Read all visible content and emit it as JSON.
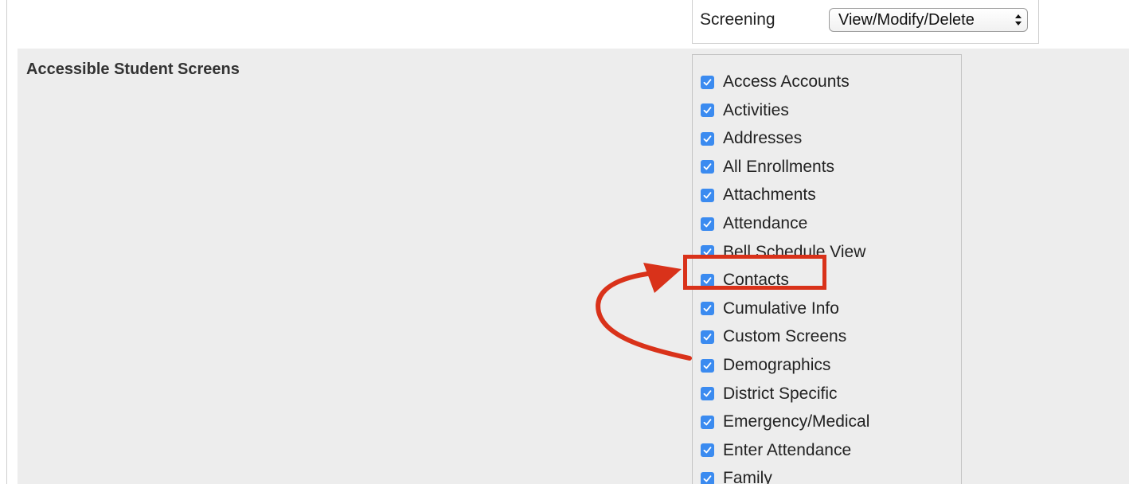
{
  "screening": {
    "label": "Screening",
    "selected_value": "View/Modify/Delete"
  },
  "accessible_screens": {
    "title": "Accessible Student Screens",
    "items": [
      {
        "label": "Access Accounts",
        "checked": true
      },
      {
        "label": "Activities",
        "checked": true
      },
      {
        "label": "Addresses",
        "checked": true
      },
      {
        "label": "All Enrollments",
        "checked": true
      },
      {
        "label": "Attachments",
        "checked": true
      },
      {
        "label": "Attendance",
        "checked": true
      },
      {
        "label": "Bell Schedule View",
        "checked": true
      },
      {
        "label": "Contacts",
        "checked": true
      },
      {
        "label": "Cumulative Info",
        "checked": true
      },
      {
        "label": "Custom Screens",
        "checked": true
      },
      {
        "label": "Demographics",
        "checked": true
      },
      {
        "label": "District Specific",
        "checked": true
      },
      {
        "label": "Emergency/Medical",
        "checked": true
      },
      {
        "label": "Enter Attendance",
        "checked": true
      },
      {
        "label": "Family",
        "checked": true
      }
    ]
  },
  "annotation": {
    "highlighted_item": "Contacts",
    "arrow_from": "Demographics",
    "color": "#d9321a"
  },
  "colors": {
    "checkbox": "#3b8bf0",
    "row_background": "#ededed"
  }
}
